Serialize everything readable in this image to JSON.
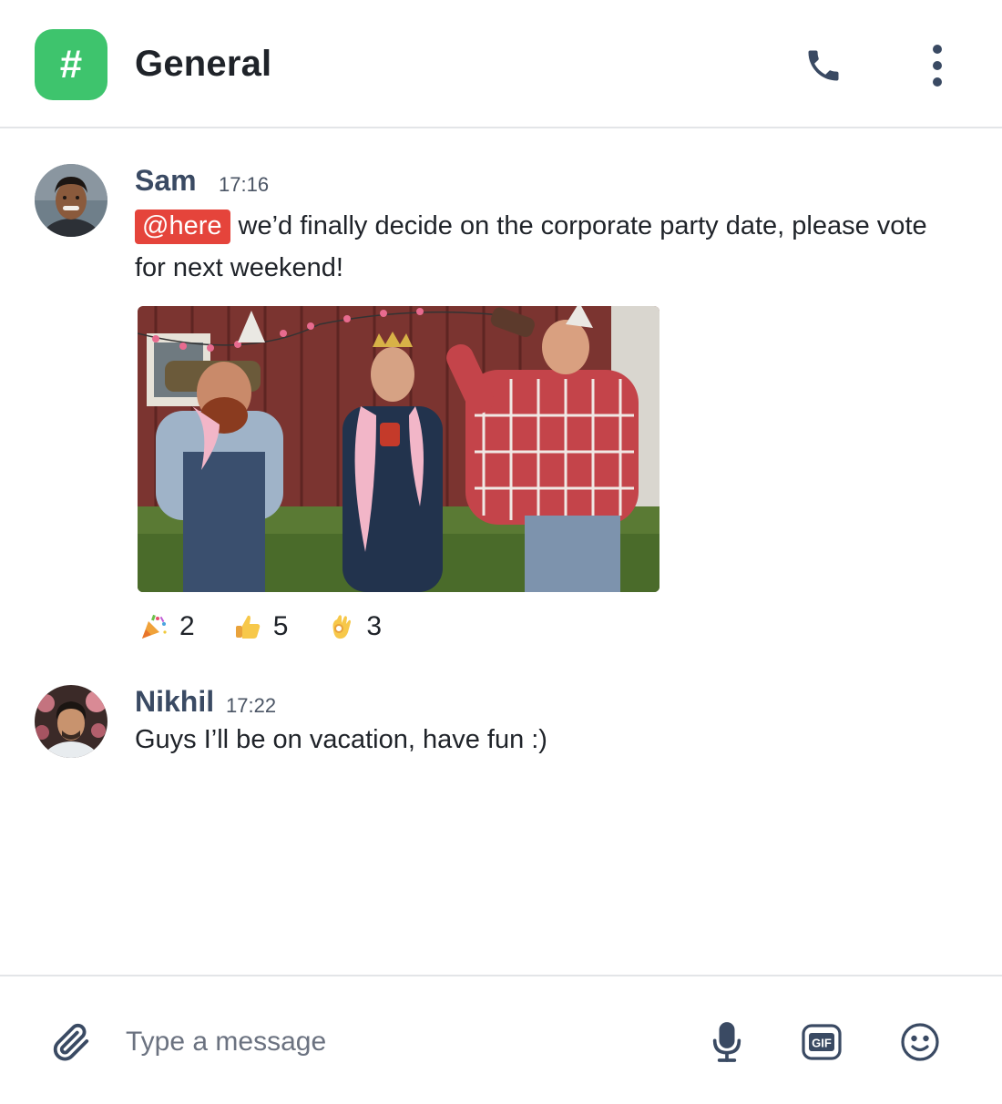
{
  "header": {
    "channel_symbol": "#",
    "title": "General",
    "channel_color": "#3ec46d",
    "icons": [
      "phone-icon",
      "more-vertical-icon"
    ]
  },
  "messages": [
    {
      "author": "Sam",
      "time": "17:16",
      "mention": "@here",
      "text": " we’d finally decide on the corporate party date, please vote for next weekend!",
      "has_gif": true,
      "reactions": [
        {
          "emoji": "party-popper-icon",
          "count": "2"
        },
        {
          "emoji": "thumbs-up-icon",
          "count": "5"
        },
        {
          "emoji": "ok-hand-icon",
          "count": "3"
        }
      ]
    },
    {
      "author": "Nikhil",
      "time": "17:22",
      "text": "Guys I’ll be on vacation, have fun :)"
    }
  ],
  "composer": {
    "placeholder": "Type a message",
    "icons": [
      "paperclip-icon",
      "microphone-icon",
      "gif-icon",
      "smiley-icon"
    ]
  },
  "colors": {
    "mention_bg": "#e5443b",
    "author_name": "#3a4a63",
    "icon": "#3a4a63"
  }
}
